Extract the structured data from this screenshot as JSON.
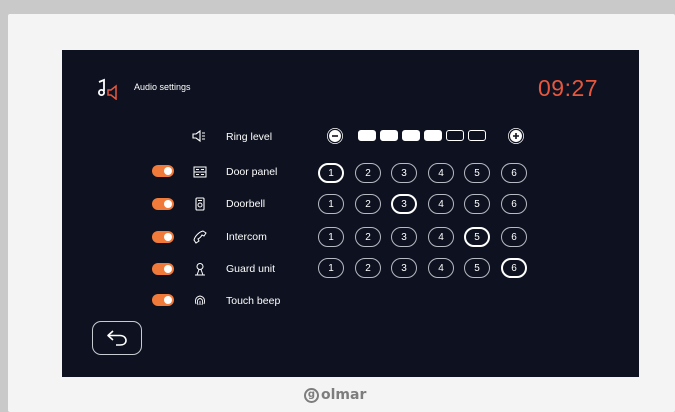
{
  "header": {
    "title": "Audio settings",
    "icon": "speaker-music-note-icon",
    "clock": "09:27"
  },
  "ring": {
    "label": "Ring level",
    "level": 4,
    "max": 6
  },
  "rows": [
    {
      "label": "Door panel",
      "icon": "door-panel-icon",
      "enabled": true,
      "selected": 1
    },
    {
      "label": "Doorbell",
      "icon": "doorbell-icon",
      "enabled": true,
      "selected": 3
    },
    {
      "label": "Intercom",
      "icon": "phone-handset-icon",
      "enabled": true,
      "selected": 5
    },
    {
      "label": "Guard unit",
      "icon": "guard-person-icon",
      "enabled": true,
      "selected": 6
    },
    {
      "label": "Touch beep",
      "icon": "fingerprint-icon",
      "enabled": true
    }
  ],
  "levels": [
    "1",
    "2",
    "3",
    "4",
    "5",
    "6"
  ],
  "brand": "olmar",
  "brand_initial": "g",
  "colors": {
    "accent": "#f07a3a",
    "clock": "#e8573d",
    "screen_bg": "#0e1220"
  }
}
